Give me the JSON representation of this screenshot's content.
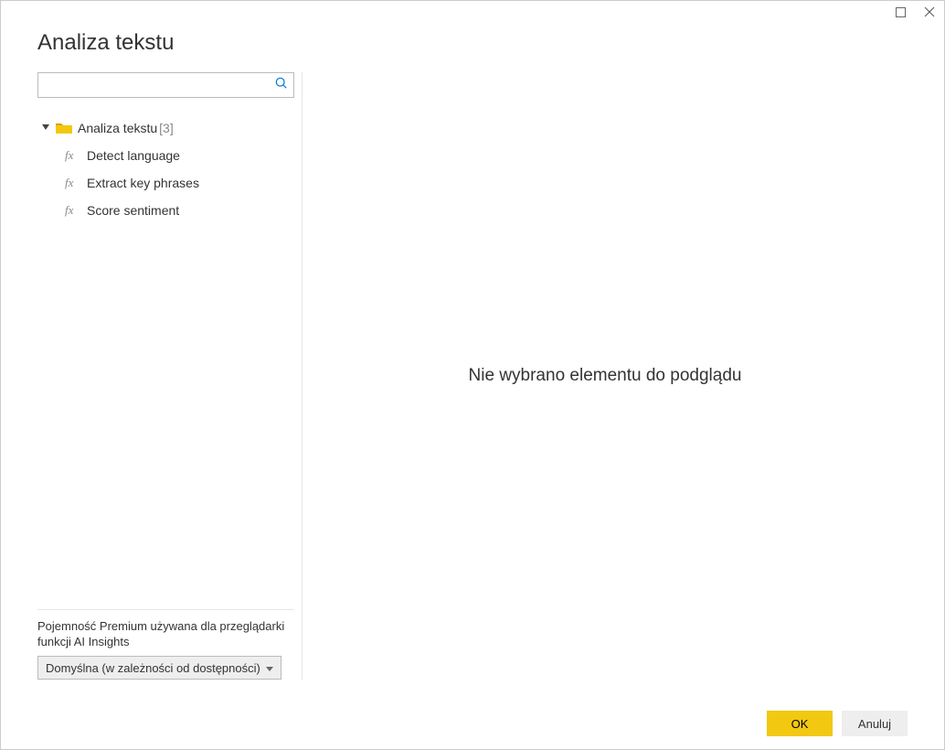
{
  "dialog": {
    "title": "Analiza tekstu"
  },
  "search": {
    "value": "",
    "placeholder": ""
  },
  "tree": {
    "root_label": "Analiza tekstu",
    "root_count": "[3]",
    "items": [
      {
        "label": "Detect language"
      },
      {
        "label": "Extract key phrases"
      },
      {
        "label": "Score sentiment"
      }
    ]
  },
  "capacity": {
    "label": "Pojemność Premium używana dla przeglądarki funkcji AI Insights",
    "selected": "Domyślna (w zależności od dostępności)"
  },
  "preview": {
    "empty_message": "Nie wybrano elementu do podglądu"
  },
  "buttons": {
    "ok": "OK",
    "cancel": "Anuluj"
  }
}
